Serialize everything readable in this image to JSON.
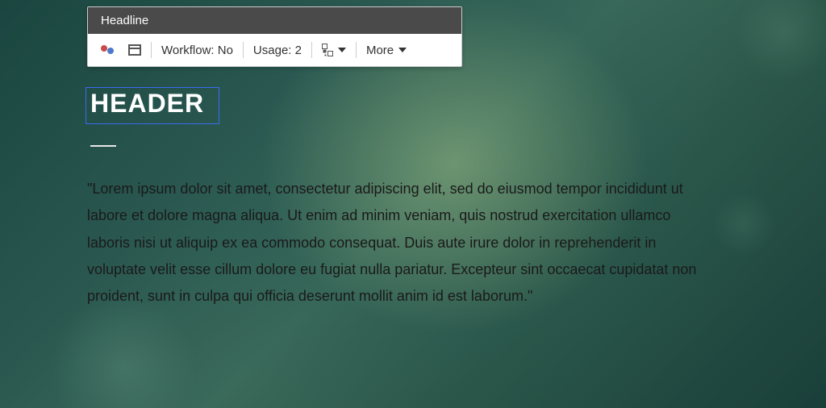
{
  "toolbar": {
    "title": "Headline",
    "workflow_label": "Workflow: No",
    "usage_label": "Usage: 2",
    "more_label": "More"
  },
  "content": {
    "header": "HEADER",
    "body": "\"Lorem ipsum dolor sit amet, consectetur adipiscing elit, sed do eiusmod tempor incididunt ut labore et dolore magna aliqua. Ut enim ad minim veniam, quis nostrud exercitation ullamco laboris nisi ut aliquip ex ea commodo consequat. Duis aute irure dolor in reprehenderit in voluptate velit esse cillum dolore eu fugiat nulla pariatur. Excepteur sint occaecat cupidatat non proident, sunt in culpa qui officia deserunt mollit anim id est laborum.\""
  }
}
